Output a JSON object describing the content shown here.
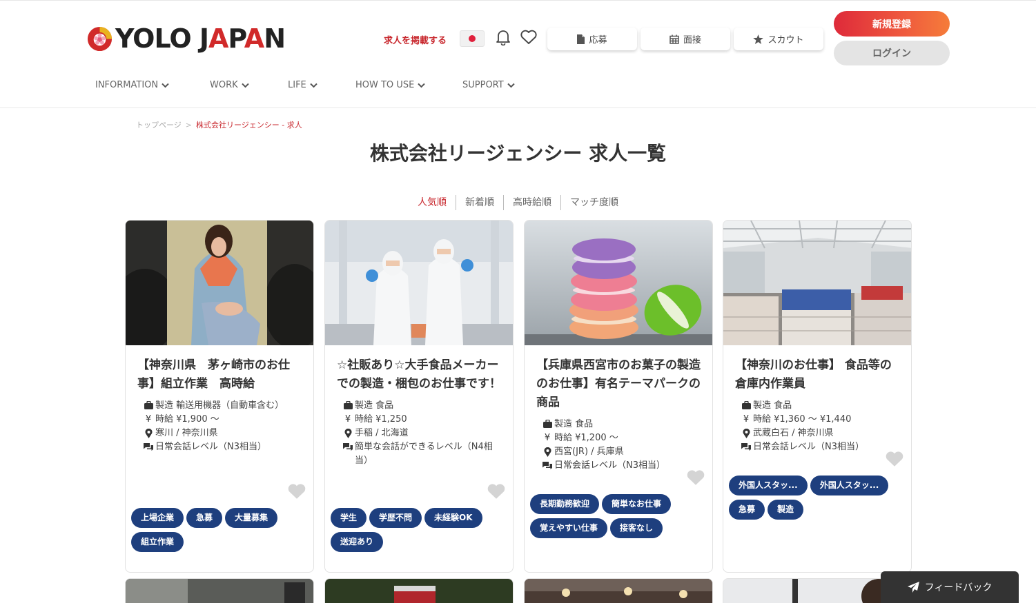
{
  "header": {
    "logo_text_main": "YOLO J",
    "logo_text_a": "A",
    "logo_text_p": "P",
    "logo_text_a2": "A",
    "logo_text_n": "N",
    "post_job_link": "求人を掲載する",
    "apply_label": "応募",
    "interview_label": "面接",
    "scout_label": "スカウト",
    "signup_label": "新規登録",
    "login_label": "ログイン"
  },
  "nav": [
    {
      "label": "INFORMATION"
    },
    {
      "label": "WORK"
    },
    {
      "label": "LIFE"
    },
    {
      "label": "HOW TO USE"
    },
    {
      "label": "SUPPORT"
    }
  ],
  "breadcrumb": {
    "home": "トップページ",
    "separator": ">",
    "current": "株式会社リージェンシー - 求人"
  },
  "page_title": "株式会社リージェンシー 求人一覧",
  "sort": [
    {
      "label": "人気順"
    },
    {
      "label": "新着順"
    },
    {
      "label": "高時給順"
    },
    {
      "label": "マッチ度順"
    }
  ],
  "cards": [
    {
      "title": "【神奈川県　茅ヶ崎市のお仕事】組立作業　高時給",
      "category": "製造 輸送用機器（自動車含む）",
      "wage": "時給 ¥1,900 〜",
      "location": "寒川 / 神奈川県",
      "language": "日常会話レベル（N3相当）",
      "tags": [
        "上場企業",
        "急募",
        "大量募集",
        "組立作業"
      ]
    },
    {
      "title": "☆社販あり☆大手食品メーカーでの製造・梱包のお仕事です！",
      "category": "製造 食品",
      "wage": "時給 ¥1,250",
      "location": "手稲 / 北海道",
      "language": "簡単な会話ができるレベル（N4相当）",
      "tags": [
        "学生",
        "学歴不問",
        "未経験OK",
        "送迎あり"
      ]
    },
    {
      "title": "【兵庫県西宮市のお菓子の製造のお仕事】有名テーマパークの商品",
      "category": "製造 食品",
      "wage": "時給 ¥1,200 〜",
      "location": "西宮(JR) / 兵庫県",
      "language": "日常会話レベル（N3相当）",
      "tags": [
        "長期勤務歓迎",
        "簡単なお仕事",
        "覚えやすい仕事",
        "接客なし"
      ]
    },
    {
      "title": "【神奈川のお仕事】 食品等の倉庫内作業員",
      "category": "製造 食品",
      "wage": "時給 ¥1,360 〜 ¥1,440",
      "location": "武蔵白石 / 神奈川県",
      "language": "日常会話レベル（N3相当）",
      "tags": [
        "外国人スタッ...",
        "外国人スタッ...",
        "急募",
        "製造"
      ]
    }
  ],
  "feedback_label": "フィードバック",
  "yen_symbol": "¥"
}
